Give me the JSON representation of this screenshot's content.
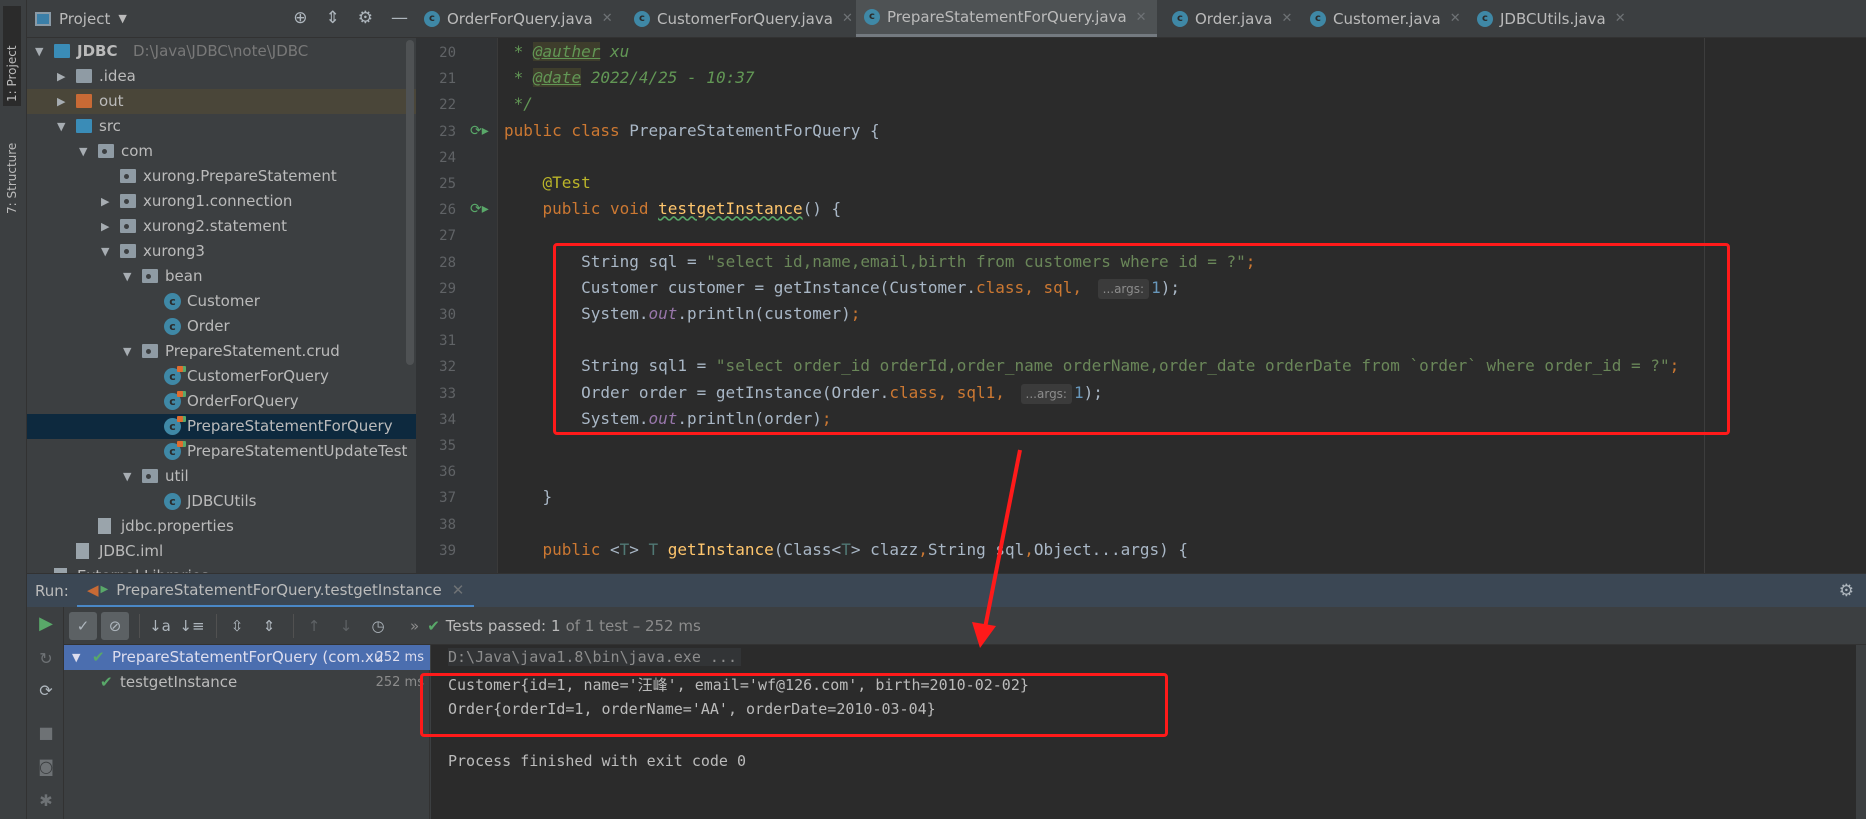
{
  "left_stripe": {
    "project_tab": "1: Project",
    "structure_tab": "7: Structure"
  },
  "project_panel": {
    "title": "Project",
    "tree": [
      {
        "label": "JDBC",
        "path": "D:\\Java\\JDBC\\note\\JDBC",
        "level": 0,
        "expanded": true,
        "icon": "module-folder-icon",
        "bold": true
      },
      {
        "label": ".idea",
        "level": 1,
        "expanded": false,
        "icon": "folder-icon"
      },
      {
        "label": "out",
        "level": 1,
        "expanded": false,
        "icon": "excluded-folder-icon",
        "highlight": true
      },
      {
        "label": "src",
        "level": 1,
        "expanded": true,
        "icon": "source-folder-icon"
      },
      {
        "label": "com",
        "level": 2,
        "expanded": true,
        "icon": "package-icon"
      },
      {
        "label": "xurong.PrepareStatement",
        "level": 3,
        "icon": "package-icon"
      },
      {
        "label": "xurong1.connection",
        "level": 3,
        "expanded": false,
        "icon": "package-icon"
      },
      {
        "label": "xurong2.statement",
        "level": 3,
        "expanded": false,
        "icon": "package-icon"
      },
      {
        "label": "xurong3",
        "level": 3,
        "expanded": true,
        "icon": "package-icon"
      },
      {
        "label": "bean",
        "level": 4,
        "expanded": true,
        "icon": "package-icon"
      },
      {
        "label": "Customer",
        "level": 5,
        "icon": "class-icon"
      },
      {
        "label": "Order",
        "level": 5,
        "icon": "class-icon"
      },
      {
        "label": "PrepareStatement.crud",
        "level": 4,
        "expanded": true,
        "icon": "package-icon"
      },
      {
        "label": "CustomerForQuery",
        "level": 5,
        "icon": "test-class-icon"
      },
      {
        "label": "OrderForQuery",
        "level": 5,
        "icon": "test-class-icon"
      },
      {
        "label": "PrepareStatementForQuery",
        "level": 5,
        "icon": "test-class-icon",
        "selected": true
      },
      {
        "label": "PrepareStatementUpdateTest",
        "level": 5,
        "icon": "test-class-icon"
      },
      {
        "label": "util",
        "level": 4,
        "expanded": true,
        "icon": "package-icon"
      },
      {
        "label": "JDBCUtils",
        "level": 5,
        "icon": "class-icon"
      },
      {
        "label": "jdbc.properties",
        "level": 2,
        "icon": "properties-file-icon"
      },
      {
        "label": "JDBC.iml",
        "level": 1,
        "icon": "iml-file-icon"
      },
      {
        "label": "External Libraries",
        "level": 0,
        "expanded": false,
        "icon": "library-icon"
      }
    ]
  },
  "tabs": [
    {
      "label": "OrderForQuery.java",
      "test": true
    },
    {
      "label": "CustomerForQuery.java",
      "test": true
    },
    {
      "label": "PrepareStatementForQuery.java",
      "test": true,
      "active": true
    },
    {
      "label": "Order.java"
    },
    {
      "label": "Customer.java"
    },
    {
      "label": "JDBCUtils.java"
    }
  ],
  "editor": {
    "first_line": 20,
    "lines": [
      [
        [
          " * ",
          "cm"
        ],
        [
          "@auther",
          "tag"
        ],
        [
          " xu",
          "cm"
        ]
      ],
      [
        [
          " * ",
          "cm"
        ],
        [
          "@date",
          "tag"
        ],
        [
          " 2022/4/25 - 10:37",
          "cm"
        ]
      ],
      [
        [
          " */",
          "cm"
        ]
      ],
      [
        [
          "public class ",
          "kw"
        ],
        [
          "PrepareStatementForQuery {",
          ""
        ]
      ],
      [],
      [
        [
          "    @Test",
          "ann"
        ]
      ],
      [
        [
          "    public void ",
          "kw"
        ],
        [
          "testgetInstance",
          "fnu"
        ],
        [
          "() {",
          ""
        ]
      ],
      [],
      [
        [
          "        String sql = ",
          ""
        ],
        [
          "\"select id,name,email,birth from customers where id = ?\"",
          "str"
        ],
        [
          ";",
          "kw"
        ]
      ],
      [
        [
          "        Customer customer = getInstance(Customer.",
          ""
        ],
        [
          "class",
          "kw"
        ],
        [
          ", sql, ",
          "kw"
        ],
        [
          "...args:",
          "hint"
        ],
        [
          "1",
          "num"
        ],
        [
          ");",
          ""
        ]
      ],
      [
        [
          "        System.",
          ""
        ],
        [
          "out",
          "st"
        ],
        [
          ".println(customer)",
          ""
        ],
        [
          ";",
          "kw"
        ]
      ],
      [],
      [
        [
          "        String sql1 = ",
          ""
        ],
        [
          "\"select order_id orderId,order_name orderName,order_date orderDate from `order` where order_id = ?\"",
          "str"
        ],
        [
          ";",
          "kw"
        ]
      ],
      [
        [
          "        Order order = getInstance(Order.",
          ""
        ],
        [
          "class",
          "kw"
        ],
        [
          ", sql1, ",
          "kw"
        ],
        [
          "...args:",
          "hint"
        ],
        [
          "1",
          "num"
        ],
        [
          ");",
          ""
        ]
      ],
      [
        [
          "        System.",
          ""
        ],
        [
          "out",
          "st"
        ],
        [
          ".println(order)",
          ""
        ],
        [
          ";",
          "kw"
        ]
      ],
      [],
      [],
      [
        [
          "    }",
          ""
        ]
      ],
      [],
      [
        [
          "    public ",
          "kw"
        ],
        [
          "<",
          ""
        ],
        [
          "T",
          "tp"
        ],
        [
          "> ",
          ""
        ],
        [
          "T ",
          "tp"
        ],
        [
          "getInstance",
          "fn"
        ],
        [
          "(Class<",
          ""
        ],
        [
          "T",
          "tp"
        ],
        [
          "> clazz",
          ""
        ],
        [
          ",",
          "kw"
        ],
        [
          "String sql",
          ""
        ],
        [
          ",",
          "kw"
        ],
        [
          "Object...args) {",
          ""
        ]
      ]
    ]
  },
  "run": {
    "label": "Run:",
    "tab": "PrepareStatementForQuery.testgetInstance",
    "status_prefix": "Tests passed:",
    "status_count": "1",
    "status_rest": "of 1 test – 252 ms",
    "tests": [
      {
        "label": "PrepareStatementForQuery (com.xu",
        "time": "252 ms",
        "selected": true
      },
      {
        "label": "testgetInstance",
        "time": "252 ms"
      }
    ],
    "output": [
      "D:\\Java\\java1.8\\bin\\java.exe ...",
      "Customer{id=1, name='汪峰', email='wf@126.com', birth=2010-02-02}",
      "Order{orderId=1, orderName='AA', orderDate=2010-03-04}",
      "",
      "Process finished with exit code 0"
    ]
  },
  "colors": {
    "annotation_red": "#ff1a1a",
    "pass_green": "#59a869",
    "selection": "#0d293e",
    "test_selection": "#4b6eaf"
  }
}
